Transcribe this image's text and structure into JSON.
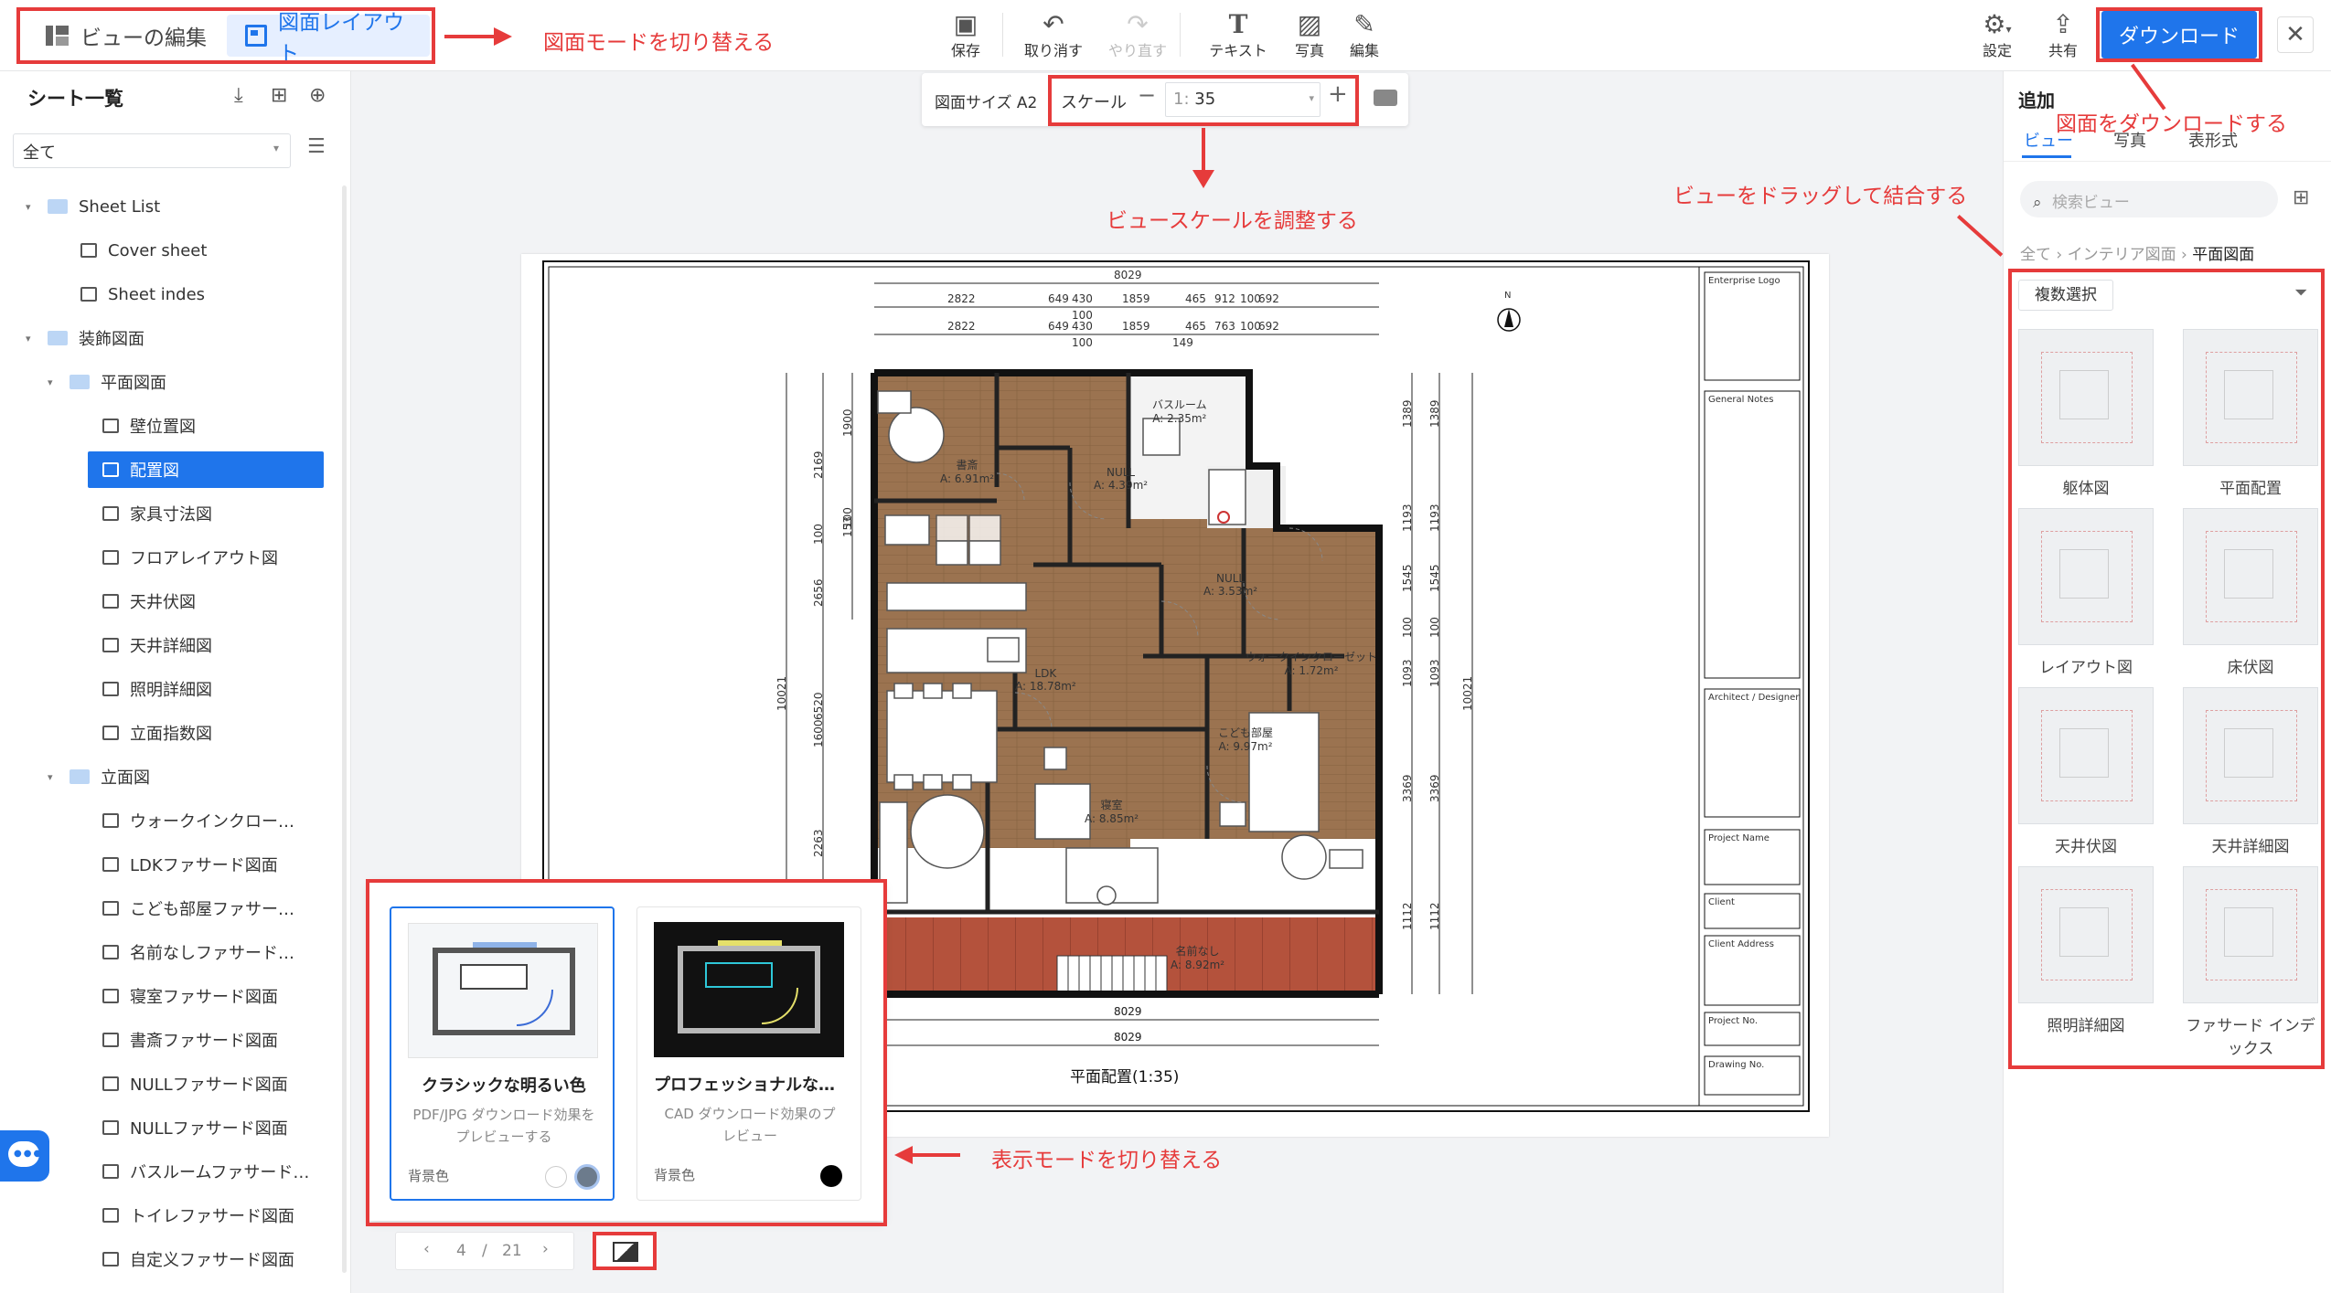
{
  "topbar": {
    "mode_edit_view": "ビューの編集",
    "mode_layout": "図面レイアウト",
    "tools": [
      {
        "label": "保存",
        "icon": "save-icon",
        "enabled": true
      },
      {
        "label": "取り消す",
        "icon": "undo-icon",
        "enabled": true
      },
      {
        "label": "やり直す",
        "icon": "redo-icon",
        "enabled": false
      },
      {
        "label": "テキスト",
        "icon": "text-icon",
        "enabled": true
      },
      {
        "label": "写真",
        "icon": "image-icon",
        "enabled": true
      },
      {
        "label": "編集",
        "icon": "edit-icon",
        "enabled": true
      }
    ],
    "settings_label": "設定",
    "share_label": "共有",
    "download_label": "ダウンロード"
  },
  "scale_bar": {
    "paper_size": "図面サイズ A2",
    "scale_label": "スケール",
    "scale_prefix": "1:",
    "scale_value": "35"
  },
  "annotations": {
    "switch_mode": "図面モードを切り替える",
    "adjust_scale": "ビュースケールを調整する",
    "download": "図面をダウンロードする",
    "drag_views": "ビューをドラッグして結合する",
    "switch_display": "表示モードを切り替える"
  },
  "sidebar": {
    "title": "シート一覧",
    "filter_value": "全て",
    "items": [
      {
        "label": "Sheet List",
        "type": "folder",
        "level": 0,
        "expanded": true
      },
      {
        "label": "Cover sheet",
        "type": "sheet",
        "level": 1
      },
      {
        "label": "Sheet indes",
        "type": "sheet",
        "level": 1
      },
      {
        "label": "装飾図面",
        "type": "folder",
        "level": 0,
        "expanded": true
      },
      {
        "label": "平面図面",
        "type": "folder",
        "level": 1,
        "expanded": true
      },
      {
        "label": "壁位置図",
        "type": "sheet",
        "level": 2
      },
      {
        "label": "配置図",
        "type": "sheet",
        "level": 2,
        "selected": true
      },
      {
        "label": "家具寸法図",
        "type": "sheet",
        "level": 2
      },
      {
        "label": "フロアレイアウト図",
        "type": "sheet",
        "level": 2
      },
      {
        "label": "天井伏図",
        "type": "sheet",
        "level": 2
      },
      {
        "label": "天井詳細図",
        "type": "sheet",
        "level": 2
      },
      {
        "label": "照明詳細図",
        "type": "sheet",
        "level": 2
      },
      {
        "label": "立面指数図",
        "type": "sheet",
        "level": 2
      },
      {
        "label": "立面図",
        "type": "folder",
        "level": 1,
        "expanded": true
      },
      {
        "label": "ウォークインクロー…",
        "type": "sheet",
        "level": 2
      },
      {
        "label": "LDKファサード図面",
        "type": "sheet",
        "level": 2
      },
      {
        "label": "こども部屋ファサー…",
        "type": "sheet",
        "level": 2
      },
      {
        "label": "名前なしファサード…",
        "type": "sheet",
        "level": 2
      },
      {
        "label": "寝室ファサード図面",
        "type": "sheet",
        "level": 2
      },
      {
        "label": "書斎ファサード図面",
        "type": "sheet",
        "level": 2
      },
      {
        "label": "NULLファサード図面",
        "type": "sheet",
        "level": 2
      },
      {
        "label": "NULLファサード図面",
        "type": "sheet",
        "level": 2
      },
      {
        "label": "バスルームファサード…",
        "type": "sheet",
        "level": 2
      },
      {
        "label": "トイレファサード図面",
        "type": "sheet",
        "level": 2
      },
      {
        "label": "自定义ファサード図面",
        "type": "sheet",
        "level": 2
      }
    ]
  },
  "pager": {
    "current": "4",
    "sep": "/",
    "total": "21"
  },
  "display_modes": [
    {
      "title": "クラシックな明るい色",
      "desc": "PDF/JPG ダウンロード効果をプレビューする",
      "bg_label": "背景色",
      "selected": true
    },
    {
      "title": "プロフェッショナルな…",
      "desc": "CAD ダウンロード効果のプレビュー",
      "bg_label": "背景色",
      "selected": false
    }
  ],
  "drawing": {
    "caption": "平面配置(1:35)",
    "north": "N",
    "rooms": [
      {
        "name": "書斎",
        "area": "A: 6.91m²"
      },
      {
        "name": "バスルーム",
        "area": "A: 2.35m²"
      },
      {
        "name": "NULL",
        "area": "A: 4.39m²"
      },
      {
        "name": "NULL",
        "area": "A: 3.53m²"
      },
      {
        "name": "ウォークインクローゼット",
        "area": "A: 1.72m²"
      },
      {
        "name": "LDK",
        "area": "A: 18.78m²"
      },
      {
        "name": "こども部屋",
        "area": "A: 9.97m²"
      },
      {
        "name": "寝室",
        "area": "A: 8.85m²"
      },
      {
        "name": "名前なし",
        "area": "A: 8.92m²"
      }
    ],
    "dims_top1": [
      "8029"
    ],
    "dims_top2": [
      "2822",
      "649",
      "430",
      "1859",
      "465",
      "912",
      "100",
      "692"
    ],
    "dims_top2b": [
      "100"
    ],
    "dims_top3": [
      "2822",
      "649",
      "430",
      "1859",
      "465",
      "763",
      "100",
      "692"
    ],
    "dims_top3b": [
      "100",
      "149"
    ],
    "dims_bottom": [
      "8029",
      "8029"
    ],
    "dims_left1": [
      "10021"
    ],
    "dims_left2": [
      "2169",
      "100",
      "2656",
      "6520",
      "1600",
      "2263",
      "1100"
    ],
    "dims_left3": [
      "1900",
      "100",
      "153"
    ],
    "dims_right1": [
      "1389",
      "1193",
      "1545",
      "100",
      "1093",
      "3369",
      "1112"
    ],
    "dims_right2": [
      "1389",
      "1193",
      "1545",
      "100",
      "1093",
      "3369",
      "1112"
    ],
    "dims_right3": [
      "10021"
    ],
    "title_block": [
      "Enterprise Logo",
      "General Notes",
      "Architect / Designer",
      "Project Name",
      "Client",
      "Client Address",
      "Project No.",
      "Drawing No."
    ]
  },
  "rightpanel": {
    "title": "追加",
    "tabs": [
      "ビュー",
      "写真",
      "表形式"
    ],
    "search_placeholder": "検索ビュー",
    "breadcrumb": [
      "全て",
      "インテリア図面",
      "平面図面"
    ],
    "multi_select": "複数選択",
    "thumbs": [
      "躯体図",
      "平面配置",
      "レイアウト図",
      "床伏図",
      "天井伏図",
      "天井詳細図",
      "照明詳細図",
      "ファサード インデックス"
    ]
  },
  "colors": {
    "accent": "#1f75eb",
    "annotation": "#e63b3b",
    "floor": "#9b7350",
    "deck": "#b4523c"
  }
}
